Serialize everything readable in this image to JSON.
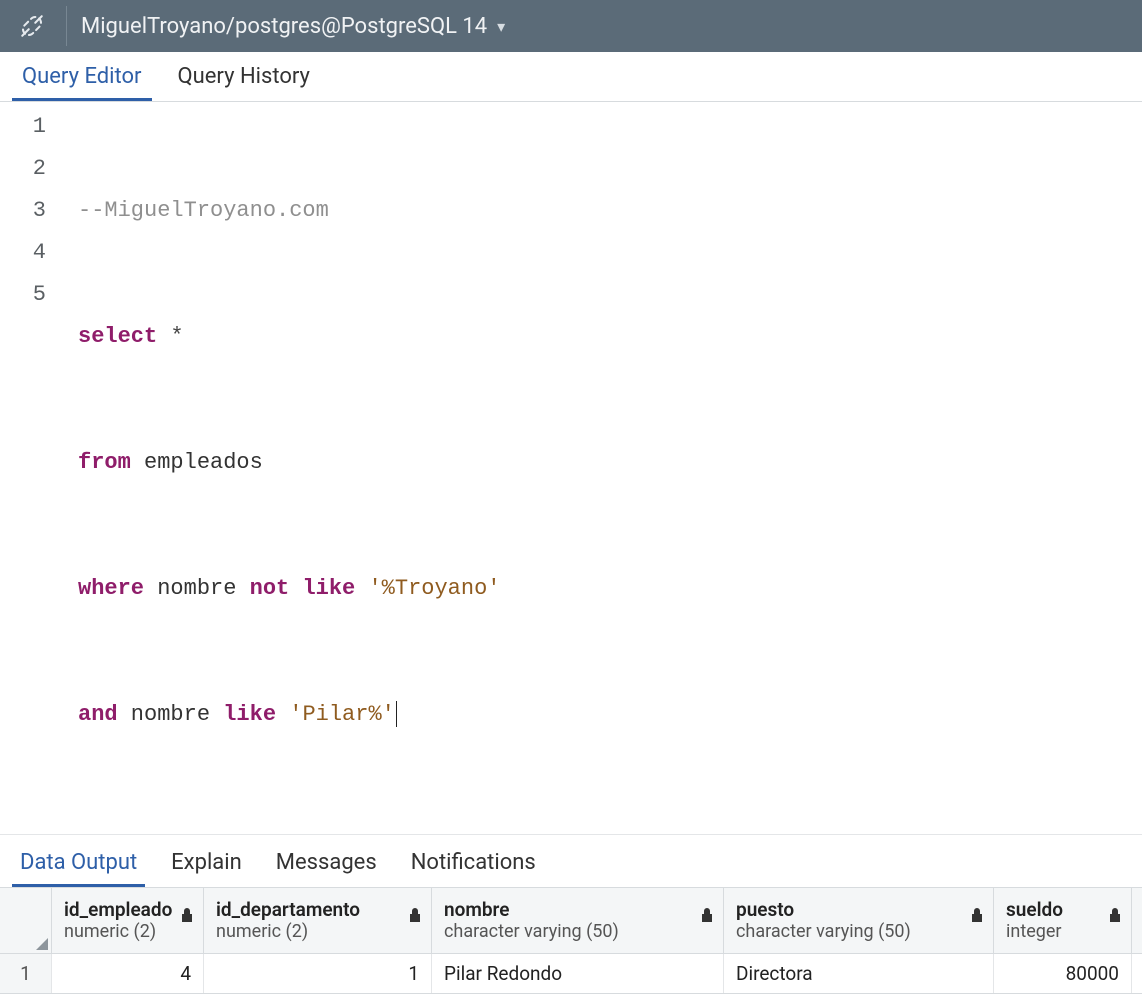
{
  "header": {
    "connection_label": "MiguelTroyano/postgres@PostgreSQL 14"
  },
  "tabs": {
    "editor": "Query Editor",
    "history": "Query History"
  },
  "editor": {
    "lines": [
      "1",
      "2",
      "3",
      "4",
      "5"
    ],
    "tokens": {
      "l1_comment": "--MiguelTroyano.com",
      "l2_select": "select",
      "l2_star": " *",
      "l3_from": "from",
      "l3_ident": " empleados",
      "l4_where": "where",
      "l4_ident": " nombre ",
      "l4_not": "not",
      "l4_space": " ",
      "l4_like": "like",
      "l4_str": " '%Troyano'",
      "l5_and": "and",
      "l5_ident": " nombre ",
      "l5_like": "like",
      "l5_str": " 'Pilar%'"
    }
  },
  "out_tabs": {
    "data": "Data Output",
    "explain": "Explain",
    "messages": "Messages",
    "notifications": "Notifications"
  },
  "grid": {
    "columns": [
      {
        "name": "id_empleado",
        "type": "numeric (2)"
      },
      {
        "name": "id_departamento",
        "type": "numeric (2)"
      },
      {
        "name": "nombre",
        "type": "character varying (50)"
      },
      {
        "name": "puesto",
        "type": "character varying (50)"
      },
      {
        "name": "sueldo",
        "type": "integer"
      }
    ],
    "rows": [
      {
        "num": "1",
        "id_empleado": "4",
        "id_departamento": "1",
        "nombre": "Pilar Redondo",
        "puesto": "Directora",
        "sueldo": "80000"
      }
    ]
  }
}
